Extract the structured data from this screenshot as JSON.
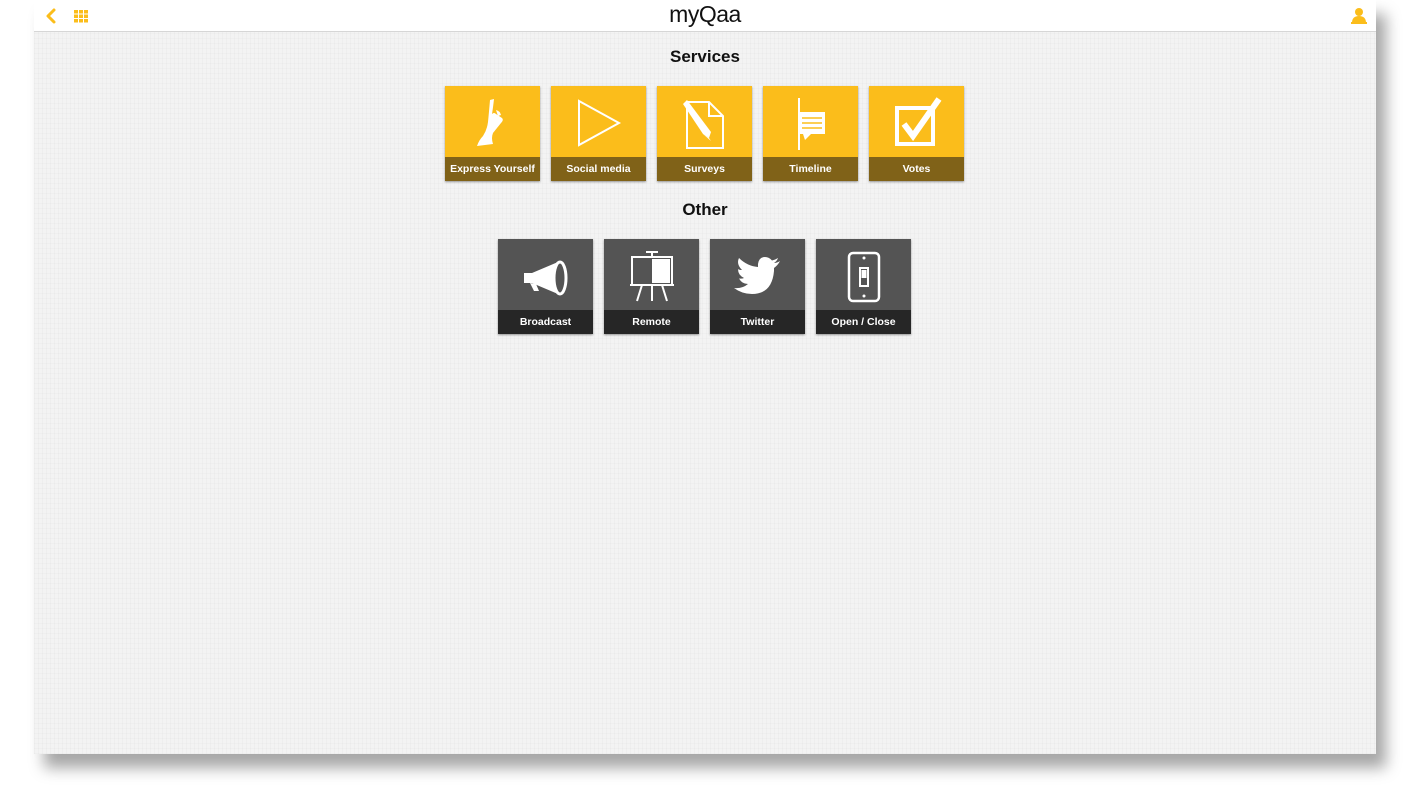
{
  "app": {
    "title": "myQaa"
  },
  "colors": {
    "accent": "#fbbd1b",
    "service_tile": "#fbbd1b",
    "service_label_bg": "#806218",
    "other_tile": "#545454",
    "other_label_bg": "#262626"
  },
  "topbar": {
    "back_icon": "chevron-left-icon",
    "grid_icon": "grid-icon",
    "user_icon": "user-icon"
  },
  "services": {
    "title": "Services",
    "tiles": [
      {
        "label": "Express Yourself",
        "icon": "raised-hand-icon"
      },
      {
        "label": "Social media",
        "icon": "play-icon"
      },
      {
        "label": "Surveys",
        "icon": "document-pen-icon"
      },
      {
        "label": "Timeline",
        "icon": "timeline-icon"
      },
      {
        "label": "Votes",
        "icon": "checkbox-icon"
      }
    ]
  },
  "other": {
    "title": "Other",
    "tiles": [
      {
        "label": "Broadcast",
        "icon": "megaphone-icon"
      },
      {
        "label": "Remote",
        "icon": "easel-icon"
      },
      {
        "label": "Twitter",
        "icon": "twitter-bird-icon"
      },
      {
        "label": "Open / Close",
        "icon": "light-switch-icon"
      }
    ]
  }
}
